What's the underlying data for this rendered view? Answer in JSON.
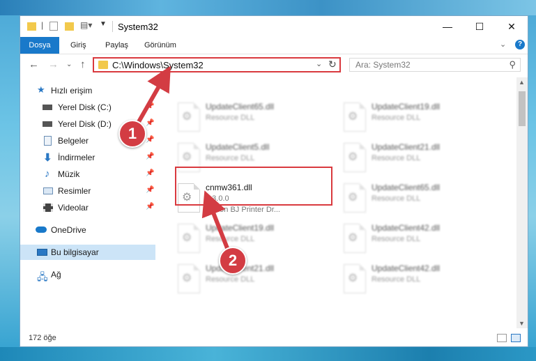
{
  "window": {
    "title": "System32",
    "controls": {
      "minimize": "—",
      "maximize": "☐",
      "close": "✕"
    }
  },
  "ribbon": {
    "tabs": [
      {
        "label": "Dosya",
        "active": true
      },
      {
        "label": "Giriş"
      },
      {
        "label": "Paylaş"
      },
      {
        "label": "Görünüm"
      }
    ],
    "help_label": "?"
  },
  "address": {
    "path": "C:\\Windows\\System32",
    "search_placeholder": "Ara: System32"
  },
  "sidebar": {
    "items": [
      {
        "label": "Hızlı erişim",
        "icon": "star-icon"
      },
      {
        "label": "Yerel Disk (C:)",
        "icon": "drive-icon",
        "pinned": true
      },
      {
        "label": "Yerel Disk (D:)",
        "icon": "drive-icon",
        "pinned": true
      },
      {
        "label": "Belgeler",
        "icon": "documents-icon",
        "pinned": true
      },
      {
        "label": "İndirmeler",
        "icon": "download-icon",
        "pinned": true
      },
      {
        "label": "Müzik",
        "icon": "music-icon",
        "pinned": true
      },
      {
        "label": "Resimler",
        "icon": "pictures-icon",
        "pinned": true
      },
      {
        "label": "Videolar",
        "icon": "videos-icon",
        "pinned": true
      },
      {
        "label": "OneDrive",
        "icon": "cloud-icon"
      },
      {
        "label": "Bu bilgisayar",
        "icon": "computer-icon",
        "selected": true
      },
      {
        "label": "Ağ",
        "icon": "network-icon"
      }
    ]
  },
  "files": [
    {
      "name": "UpdateClient65.dll",
      "type": "Resource DLL"
    },
    {
      "name": "UpdateClient19.dll",
      "type": "Resource DLL"
    },
    {
      "name": "UpdateClient5.dll",
      "type": "Resource DLL"
    },
    {
      "name": "UpdateClient21.dll",
      "type": "Resource DLL"
    },
    {
      "name": "cnmw361.dll",
      "version": "0.3.0.0",
      "description": "Canon BJ Printer Dr...",
      "highlighted": true
    },
    {
      "name": "UpdateClient65.dll",
      "type": "Resource DLL"
    },
    {
      "name": "UpdateClient19.dll",
      "type": "Resource DLL"
    },
    {
      "name": "UpdateClient42.dll",
      "type": "Resource DLL"
    },
    {
      "name": "UpdateClient21.dll",
      "type": "Resource DLL"
    },
    {
      "name": "UpdateClient42.dll",
      "type": "Resource DLL"
    }
  ],
  "status": {
    "item_count": "172 öğe"
  },
  "annotations": {
    "step1": "1",
    "step2": "2"
  },
  "colors": {
    "accent": "#1979ca",
    "highlight": "#d9393e"
  }
}
